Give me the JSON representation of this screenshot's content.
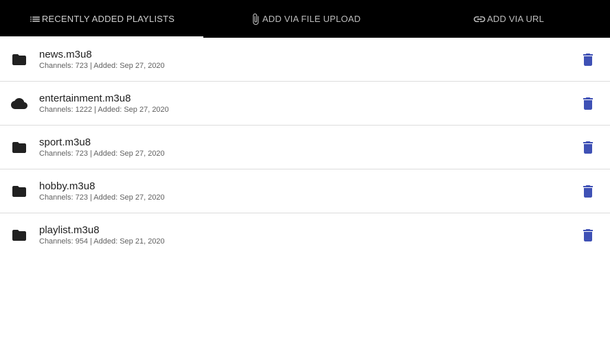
{
  "tabs": [
    {
      "label": "RECENTLY ADDED PLAYLISTS",
      "icon": "list-icon"
    },
    {
      "label": "ADD VIA FILE UPLOAD",
      "icon": "paperclip-icon"
    },
    {
      "label": "ADD VIA URL",
      "icon": "link-icon"
    }
  ],
  "colors": {
    "tabbar_bg": "#000000",
    "tab_text": "#bdbdbd",
    "delete_icon": "#3f51b5",
    "divider": "#dcdcdc"
  },
  "playlists": [
    {
      "name": "news.m3u8",
      "meta": "Channels: 723 | Added: Sep 27, 2020",
      "icon": "folder-icon"
    },
    {
      "name": "entertainment.m3u8",
      "meta": "Channels: 1222 | Added: Sep 27, 2020",
      "icon": "cloud-icon"
    },
    {
      "name": "sport.m3u8",
      "meta": "Channels: 723 | Added: Sep 27, 2020",
      "icon": "folder-icon"
    },
    {
      "name": "hobby.m3u8",
      "meta": "Channels: 723 | Added: Sep 27, 2020",
      "icon": "folder-icon"
    },
    {
      "name": "playlist.m3u8",
      "meta": "Channels: 954 | Added: Sep 21, 2020",
      "icon": "folder-icon"
    }
  ]
}
